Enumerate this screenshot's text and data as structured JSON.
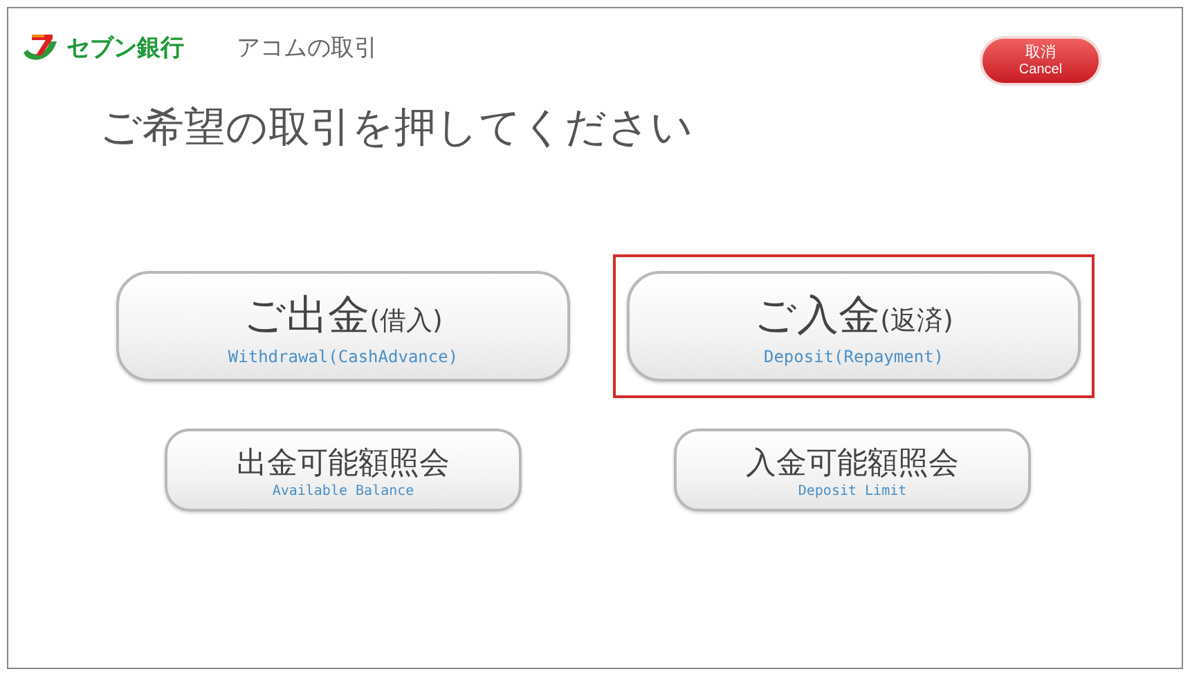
{
  "header": {
    "brand": "セブン銀行",
    "title": "アコムの取引"
  },
  "cancel_button": {
    "label": "取消",
    "sublabel": "Cancel"
  },
  "heading": "ご希望の取引を押してください",
  "rows": [
    {
      "buttons": [
        {
          "kind": "large",
          "label": "ご出金",
          "note": "(借入)",
          "sublabel": "Withdrawal(CashAdvance)",
          "highlighted": false
        },
        {
          "kind": "large",
          "label": "ご入金",
          "note": "(返済)",
          "sublabel": "Deposit(Repayment)",
          "highlighted": true
        }
      ]
    },
    {
      "buttons": [
        {
          "kind": "small",
          "label": "出金可能額照会",
          "sublabel": "Available Balance",
          "highlighted": false
        },
        {
          "kind": "small",
          "label": "入金可能額照会",
          "sublabel": "Deposit Limit",
          "highlighted": false
        }
      ]
    }
  ]
}
